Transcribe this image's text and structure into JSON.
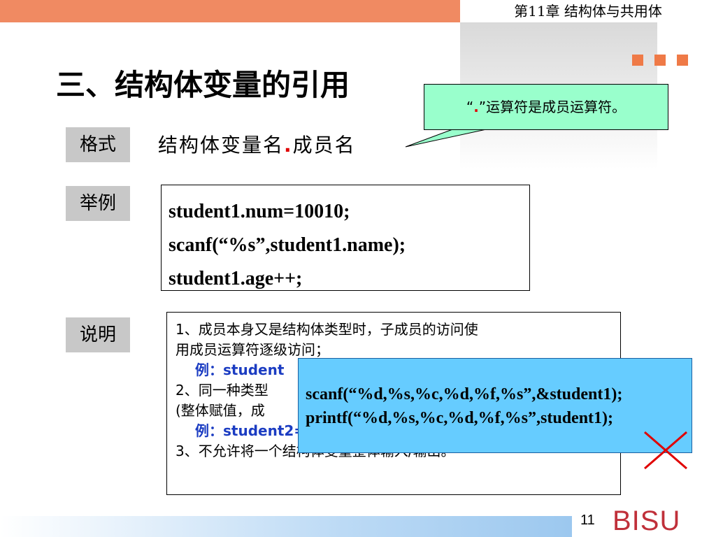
{
  "header": {
    "chapter": "第11章  结构体与共用体"
  },
  "slide": {
    "title": "三、结构体变量的引用"
  },
  "format": {
    "label": "格式",
    "text_before": "结构体变量名",
    "dot": ".",
    "text_after": "成员名"
  },
  "callout": {
    "quote_open": "“",
    "dot": ".",
    "text": "”运算符是成员运算符。"
  },
  "example": {
    "label": "举例",
    "lines": [
      "student1.num=10010;",
      "scanf(“%s”,student1.name);",
      "student1.age++;"
    ]
  },
  "notes": {
    "label": "说明",
    "lines": [
      "1、成员本身又是结构体类型时，子成员的访问使",
      "用成员运算符逐级访问；",
      "例：student",
      "2、同一种类型",
      "(整体赋值，成",
      "例：student2=stu",
      "3、不允许将一个结构体变量整体输入/输出。"
    ]
  },
  "overlay": {
    "lines": [
      "scanf(“%d,%s,%c,%d,%f,%s”,&student1);",
      "printf(“%d,%s,%c,%d,%f,%s”,student1);"
    ],
    "icon": "cross-icon"
  },
  "footer": {
    "page": "11",
    "logo": "BISU"
  },
  "colors": {
    "accent": "#f08a62",
    "callout_bg": "#99ffcc",
    "overlay_bg": "#66ccff",
    "example_text": "#1b3cc2",
    "cross": "#e00000",
    "logo": "#c0303a"
  }
}
